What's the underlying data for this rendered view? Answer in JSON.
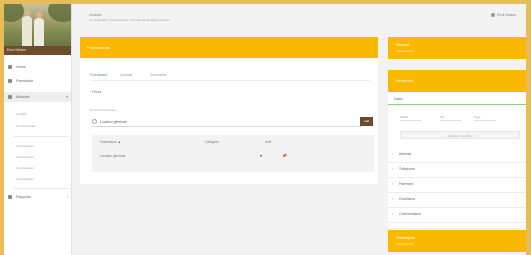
{
  "colors": {
    "accent": "#fbb800",
    "brand_brown": "#6b4a30",
    "page_border": "#e8bd55",
    "section_line": "#8fd07d"
  },
  "sidebar": {
    "user_name": "Erick Nelson",
    "items": [
      {
        "label": "Home",
        "icon": "home-icon"
      },
      {
        "label": "Formulaire",
        "icon": "document-icon"
      },
      {
        "label": "Modules",
        "icon": "grid-icon",
        "active": true
      },
      {
        "label": "Rapports",
        "icon": "chart-icon"
      }
    ],
    "sub_items": [
      "Locatifs",
      "Commerciales",
      "Fournisseurs",
      "Fournisseurs",
      "Fournisseurs",
      "Fournisseurs"
    ]
  },
  "header": {
    "breadcrumb": "Modules",
    "subtitle": "Commerciales / Fournisseurs / Contrats de location et autres",
    "user": "Erick Nelson"
  },
  "main": {
    "title": "Fournisseurs",
    "tabs": [
      "Fournisseur",
      "Contrats",
      "Documents"
    ],
    "filter_label": "Filtres",
    "field_label": "Nom du fournisseur",
    "field_value": "Location générale",
    "add_button": "Add",
    "table": {
      "headers": [
        "Fournisseur",
        "Catégorie",
        "Actif"
      ],
      "rows": [
        [
          "Location générale",
          "",
          ""
        ]
      ]
    }
  },
  "right": {
    "top_card": {
      "title": "Résumé",
      "subtitle": "Fournisseurs"
    },
    "panel": {
      "title": "Recherche",
      "section": "Dates",
      "fields": [
        "Début",
        "Fin",
        "Type"
      ],
      "button": "Appliquer les filtres",
      "accordion": [
        "Adresse",
        "Téléphone",
        "Paiement",
        "Conditions",
        "Commentaires"
      ]
    },
    "bottom_card": {
      "title": "Statistiques",
      "subtitle": "Fournisseurs"
    }
  }
}
